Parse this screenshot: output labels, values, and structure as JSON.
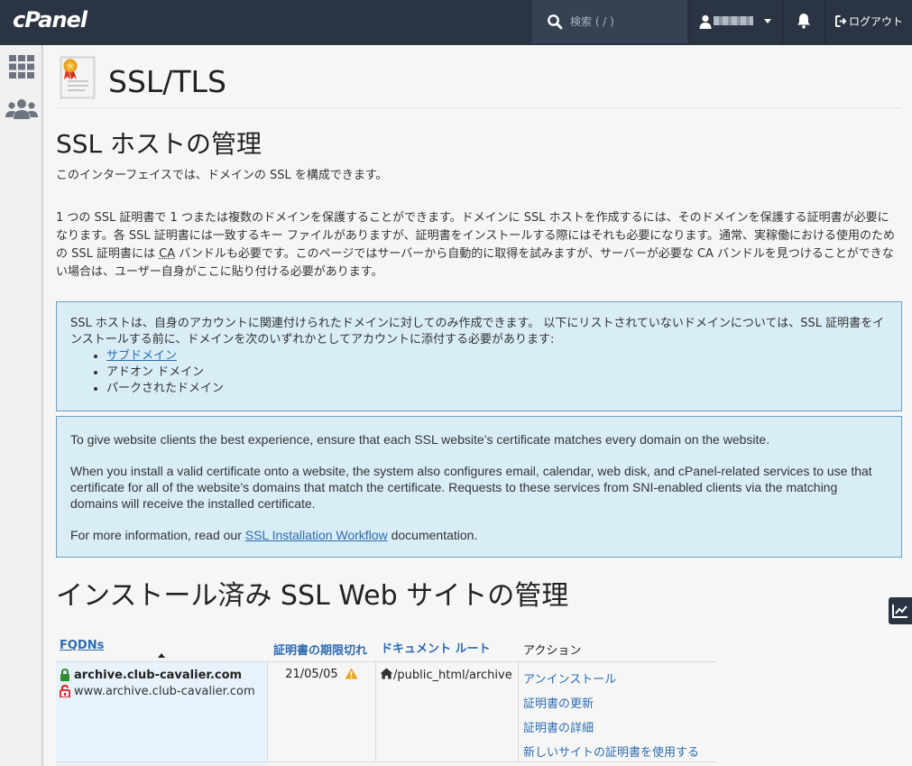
{
  "header": {
    "brand": "cPanel",
    "search_placeholder": "検索 ( / )",
    "logout_label": "ログアウト"
  },
  "page": {
    "title": "SSL/TLS"
  },
  "ssl_hosts": {
    "heading": "SSL ホストの管理",
    "intro": "このインターフェイスでは、ドメインの SSL を構成できます。",
    "description_1": "1 つの SSL 証明書で 1 つまたは複数のドメインを保護することができます。ドメインに SSL ホストを作成するには、そのドメインを保護する証明書が必要になります。各 SSL 証明書には一致するキー ファイルがありますが、証明書をインストールする際にはそれも必要になります。通常、実稼働における使用のための SSL 証明書には ",
    "description_ca": "CA",
    "description_2": " バンドルも必要です。このページではサーバーから自動的に取得を試みますが、サーバーが必要な CA バンドルを見つけることができない場合は、ユーザー自身がここに貼り付ける必要があります。"
  },
  "info_box_1": {
    "text": "SSL ホストは、自身のアカウントに関連付けられたドメインに対してのみ作成できます。 以下にリストされていないドメインについては、SSL 証明書をインストールする前に、ドメインを次のいずれかとしてアカウントに添付する必要があります:",
    "items": [
      "サブドメイン",
      "アドオン ドメイン",
      "パークされたドメイン"
    ]
  },
  "info_box_2": {
    "p1": "To give website clients the best experience, ensure that each SSL website’s certificate matches every domain on the website.",
    "p2": "When you install a valid certificate onto a website, the system also configures email, calendar, web disk, and cPanel-related services to use that certificate for all of the website’s domains that match the certificate. Requests to these services from SNI-enabled clients via the matching domains will receive the installed certificate.",
    "p3_prefix": "For more information, read our ",
    "p3_link": "SSL Installation Workflow",
    "p3_suffix": " documentation."
  },
  "installed_sites": {
    "heading": "インストール済み SSL Web サイトの管理",
    "columns": {
      "fqdns": "FQDNs",
      "expiration": "証明書の期限切れ",
      "doc_root": "ドキュメント ルート",
      "actions": "アクション"
    },
    "rows": [
      {
        "domain": "archive.club-cavalier.com",
        "alt_domain": "www.archive.club-cavalier.com",
        "expires": "21/05/05",
        "doc_root": "/public_html/archive",
        "actions": [
          "アンインストール",
          "証明書の更新",
          "証明書の詳細",
          "新しいサイトの証明書を使用する"
        ]
      }
    ]
  },
  "colors": {
    "topbar": "#2a3443",
    "link": "#2d6cb0",
    "info_bg": "#d9edf7",
    "info_border": "#6aa0c8",
    "lock_secure": "#2e8b2e",
    "lock_insecure": "#d62020",
    "warning": "#e8a21a"
  }
}
